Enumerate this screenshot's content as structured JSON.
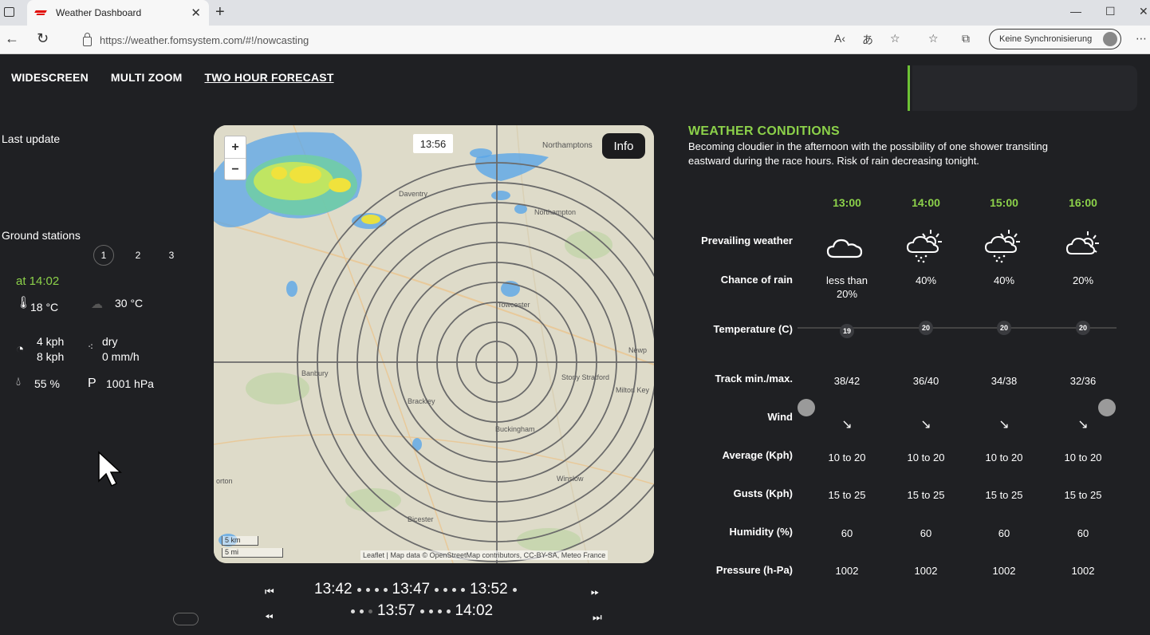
{
  "browser": {
    "tab_title": "Weather Dashboard",
    "url": "https://weather.fomsystem.com/#!/nowcasting",
    "profile_label": "Keine Synchronisierung"
  },
  "nav": {
    "widescreen": "WIDESCREEN",
    "multizoom": "MULTI ZOOM",
    "two_hour": "TWO HOUR FORECAST"
  },
  "left": {
    "last_update": "Last update",
    "ground_stations": "Ground stations",
    "stations": [
      "1",
      "2",
      "3"
    ],
    "time": "at 14:02",
    "air_temp": "18 °C",
    "track_temp": "30 °C",
    "wind_speed": "4 kph",
    "wind_gust": "8 kph",
    "rain_state": "dry",
    "rain_rate": "0 mm/h",
    "humidity": "55 %",
    "pressure_icon": "P",
    "pressure": "1001 hPa"
  },
  "map": {
    "zoom_in": "+",
    "zoom_out": "−",
    "time": "13:56",
    "info": "Info",
    "scale_km": "5 km",
    "scale_mi": "5 mi",
    "attribution": "Leaflet | Map data © OpenStreetMap contributors, CC-BY-SA, Meteo France",
    "places": {
      "northamptons": "Northamptons",
      "daventry": "Daventry",
      "northampton": "Northampton",
      "towcester": "Towcester",
      "newp": "Newp",
      "banbury": "Banbury",
      "stony": "Stony Stratford",
      "milton": "Milton Key",
      "brackley": "Brackley",
      "buckingham": "Buckingham",
      "orton": "orton",
      "winslow": "Winslow",
      "bicester": "Bicester"
    }
  },
  "timeline": {
    "row1": [
      "13:42",
      "13:47",
      "13:52"
    ],
    "row2": [
      "13:57",
      "14:02"
    ]
  },
  "conditions": {
    "title": "WEATHER CONDITIONS",
    "description": "Becoming cloudier in the afternoon with the possibility of one shower transiting eastward during the race hours. Risk of rain decreasing tonight.",
    "hours": [
      "13:00",
      "14:00",
      "15:00",
      "16:00"
    ],
    "labels": {
      "prevailing": "Prevailing weather",
      "chance": "Chance of rain",
      "temperature": "Temperature (C)",
      "track": "Track min./max.",
      "wind": "Wind",
      "average": "Average (Kph)",
      "gusts": "Gusts (Kph)",
      "humidity": "Humidity (%)",
      "pressure": "Pressure (h-Pa)"
    },
    "weather_icons": [
      "cloud-icon",
      "sun-cloud-rain-icon",
      "sun-cloud-rain-icon",
      "sun-cloud-icon"
    ],
    "chance": [
      [
        "less than",
        "20%"
      ],
      [
        "40%",
        ""
      ],
      [
        "40%",
        ""
      ],
      [
        "20%",
        ""
      ]
    ],
    "temperature": [
      "19",
      "20",
      "20",
      "20"
    ],
    "track": [
      "38/42",
      "36/40",
      "34/38",
      "32/36"
    ],
    "wind_dir": [
      "↘",
      "↘",
      "↘",
      "↘"
    ],
    "average": [
      "10 to 20",
      "10 to 20",
      "10 to 20",
      "10 to 20"
    ],
    "gusts": [
      "15 to 25",
      "15 to 25",
      "15 to 25",
      "15 to 25"
    ],
    "humidity": [
      "60",
      "60",
      "60",
      "60"
    ],
    "pressure": [
      "1002",
      "1002",
      "1002",
      "1002"
    ]
  }
}
